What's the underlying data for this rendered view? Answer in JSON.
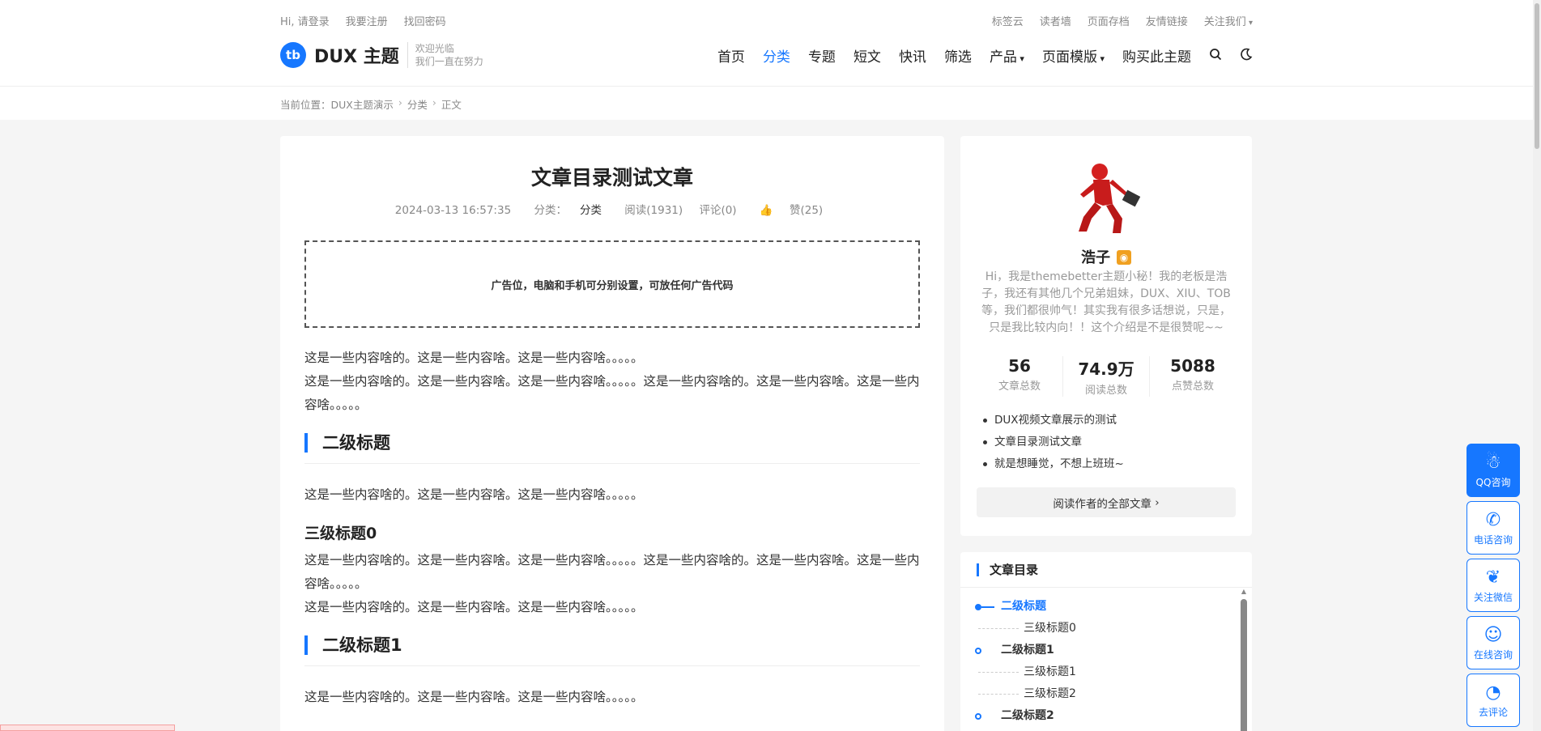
{
  "topbar": {
    "links_left": [
      "Hi, 请登录",
      "我要注册",
      "找回密码"
    ],
    "links_right": [
      "标签云",
      "读者墙",
      "页面存档",
      "友情链接",
      "关注我们"
    ]
  },
  "logo": {
    "mark": "tb",
    "name": "DUX 主题",
    "slogan_1": "欢迎光临",
    "slogan_2": "我们一直在努力"
  },
  "nav": {
    "items": [
      "首页",
      "分类",
      "专题",
      "短文",
      "快讯",
      "筛选",
      "产品",
      "页面模版",
      "购买此主题"
    ],
    "active": "分类"
  },
  "breadcrumb": {
    "prefix": "当前位置：",
    "items": [
      "DUX主题演示",
      "分类",
      "正文"
    ]
  },
  "article": {
    "title": "文章目录测试文章",
    "date": "2024-03-13 16:57:35",
    "category_label": "分类：",
    "category": "分类",
    "views": "阅读(1931)",
    "comments": "评论(0)",
    "likes": "赞(25)",
    "ad_text": "广告位，电脑和手机可分别设置，可放任何广告代码",
    "p1": "这是一些内容啥的。这是一些内容啥。这是一些内容啥。。。。。",
    "p2": "这是一些内容啥的。这是一些内容啥。这是一些内容啥。。。。。这是一些内容啥的。这是一些内容啥。这是一些内容啥。。。。。",
    "h2_0": "二级标题",
    "p3": "这是一些内容啥的。这是一些内容啥。这是一些内容啥。。。。。",
    "h3_0": "三级标题0",
    "p4": "这是一些内容啥的。这是一些内容啥。这是一些内容啥。。。。。这是一些内容啥的。这是一些内容啥。这是一些内容啥。。。。。",
    "p5": "这是一些内容啥的。这是一些内容啥。这是一些内容啥。。。。。",
    "h2_1": "二级标题1",
    "p6": "这是一些内容啥的。这是一些内容啥。这是一些内容啥。。。。。"
  },
  "author": {
    "name": "浩子",
    "bio": "Hi，我是themebetter主题小秘！我的老板是浩子，我还有其他几个兄弟姐妹，DUX、XIU、TOB等，我们都很帅气！其实我有很多话想说，只是，只是我比较内向！！这个介绍是不是很赞呢~~",
    "stats": [
      {
        "num": "56",
        "label": "文章总数"
      },
      {
        "num": "74.9万",
        "label": "阅读总数"
      },
      {
        "num": "5088",
        "label": "点赞总数"
      }
    ],
    "recent": [
      "DUX视频文章展示的测试",
      "文章目录测试文章",
      "就是想睡觉，不想上班班~"
    ],
    "read_all": "阅读作者的全部文章"
  },
  "toc": {
    "title": "文章目录",
    "items": [
      {
        "level": 2,
        "label": "二级标题"
      },
      {
        "level": 3,
        "label": "三级标题0"
      },
      {
        "level": 2,
        "label": "二级标题1"
      },
      {
        "level": 3,
        "label": "三级标题1"
      },
      {
        "level": 3,
        "label": "三级标题2"
      },
      {
        "level": 2,
        "label": "二级标题2"
      }
    ]
  },
  "float_bar": [
    "QQ咨询",
    "电话咨询",
    "关注微信",
    "在线咨询",
    "去评论"
  ],
  "colors": {
    "accent": "#1677ff",
    "rss": "#f0a020"
  }
}
